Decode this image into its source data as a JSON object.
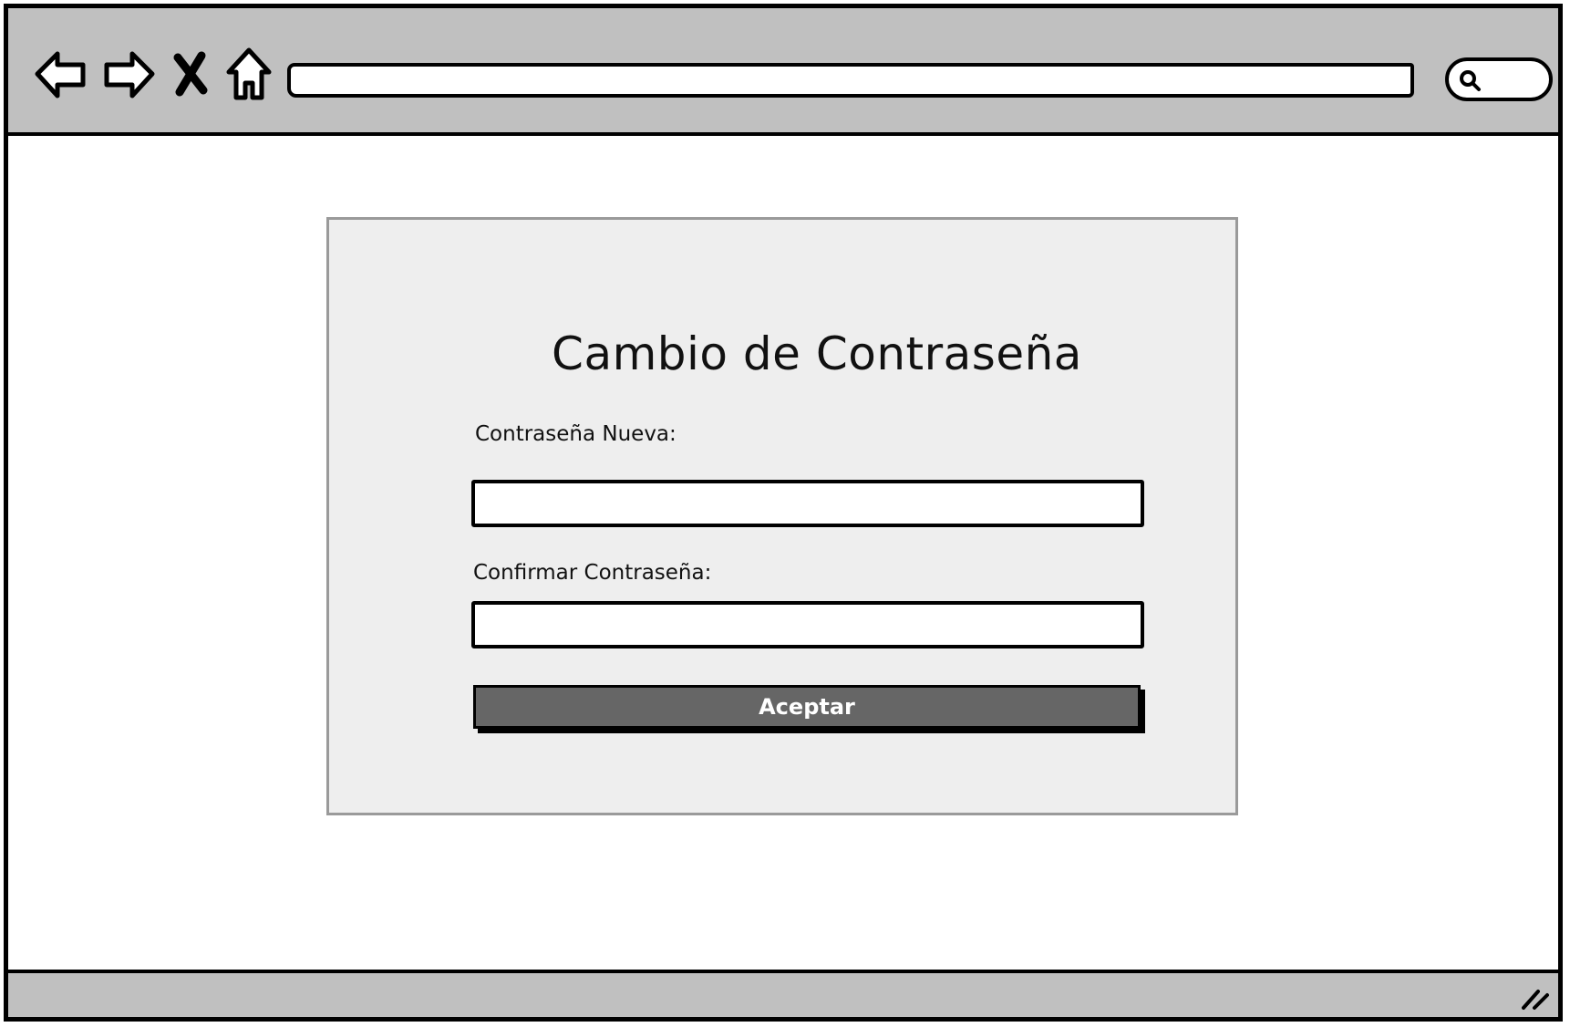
{
  "browser": {
    "icons": [
      "back-arrow-icon",
      "forward-arrow-icon",
      "close-icon",
      "home-icon",
      "search-icon",
      "resize-grip-icon"
    ],
    "address_value": "",
    "search_value": ""
  },
  "form": {
    "title": "Cambio de Contraseña",
    "new_password_label": "Contraseña Nueva:",
    "new_password_value": "",
    "confirm_password_label": "Confirmar Contraseña:",
    "confirm_password_value": "",
    "submit_label": "Aceptar"
  },
  "colors": {
    "chrome": "#c0c0c0",
    "panel": "#eeeeee",
    "panel_border": "#9a9a9a",
    "button": "#666666",
    "button_text": "#ffffff"
  }
}
